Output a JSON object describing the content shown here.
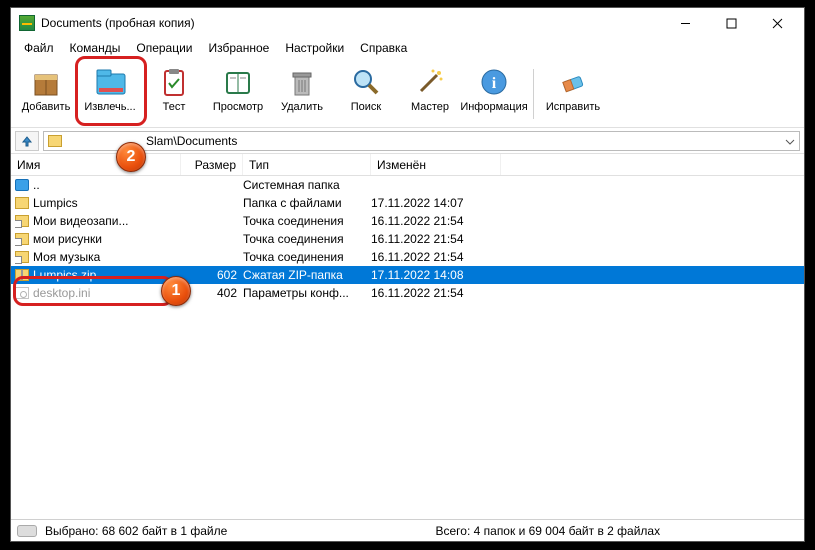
{
  "window": {
    "title": "Documents (пробная копия)"
  },
  "menu": {
    "file": "Файл",
    "commands": "Команды",
    "operations": "Операции",
    "favorites": "Избранное",
    "settings": "Настройки",
    "help": "Справка"
  },
  "toolbar": {
    "add": "Добавить",
    "extract": "Извлечь...",
    "test": "Тест",
    "view": "Просмотр",
    "delete": "Удалить",
    "search": "Поиск",
    "wizard": "Мастер",
    "info": "Информация",
    "repair": "Исправить"
  },
  "address": {
    "path_visible": "Slam\\Documents"
  },
  "columns": {
    "name": "Имя",
    "size": "Размер",
    "type": "Тип",
    "modified": "Изменён"
  },
  "rows": [
    {
      "icon": "drive",
      "name": "..",
      "size": "",
      "type": "Системная папка",
      "date": "",
      "selected": false,
      "dimmed": false
    },
    {
      "icon": "folder",
      "name": "Lumpics",
      "size": "",
      "type": "Папка с файлами",
      "date": "17.11.2022 14:07",
      "selected": false,
      "dimmed": false
    },
    {
      "icon": "shortcut",
      "name": "Мои видеозапи...",
      "size": "",
      "type": "Точка соединения",
      "date": "16.11.2022 21:54",
      "selected": false,
      "dimmed": false
    },
    {
      "icon": "shortcut",
      "name": "мои рисунки",
      "size": "",
      "type": "Точка соединения",
      "date": "16.11.2022 21:54",
      "selected": false,
      "dimmed": false
    },
    {
      "icon": "shortcut",
      "name": "Моя музыка",
      "size": "",
      "type": "Точка соединения",
      "date": "16.11.2022 21:54",
      "selected": false,
      "dimmed": false
    },
    {
      "icon": "zip",
      "name": "Lumpics.zip",
      "size": "602",
      "type": "Сжатая ZIP-папка",
      "date": "17.11.2022 14:08",
      "selected": true,
      "dimmed": false
    },
    {
      "icon": "ini",
      "name": "desktop.ini",
      "size": "402",
      "type": "Параметры конф...",
      "date": "16.11.2022 21:54",
      "selected": false,
      "dimmed": true
    }
  ],
  "status": {
    "left": "Выбрано: 68 602 байт в 1 файле",
    "right": "Всего: 4 папок и 69 004 байт в 2 файлах"
  },
  "markers": {
    "m1": "1",
    "m2": "2"
  }
}
